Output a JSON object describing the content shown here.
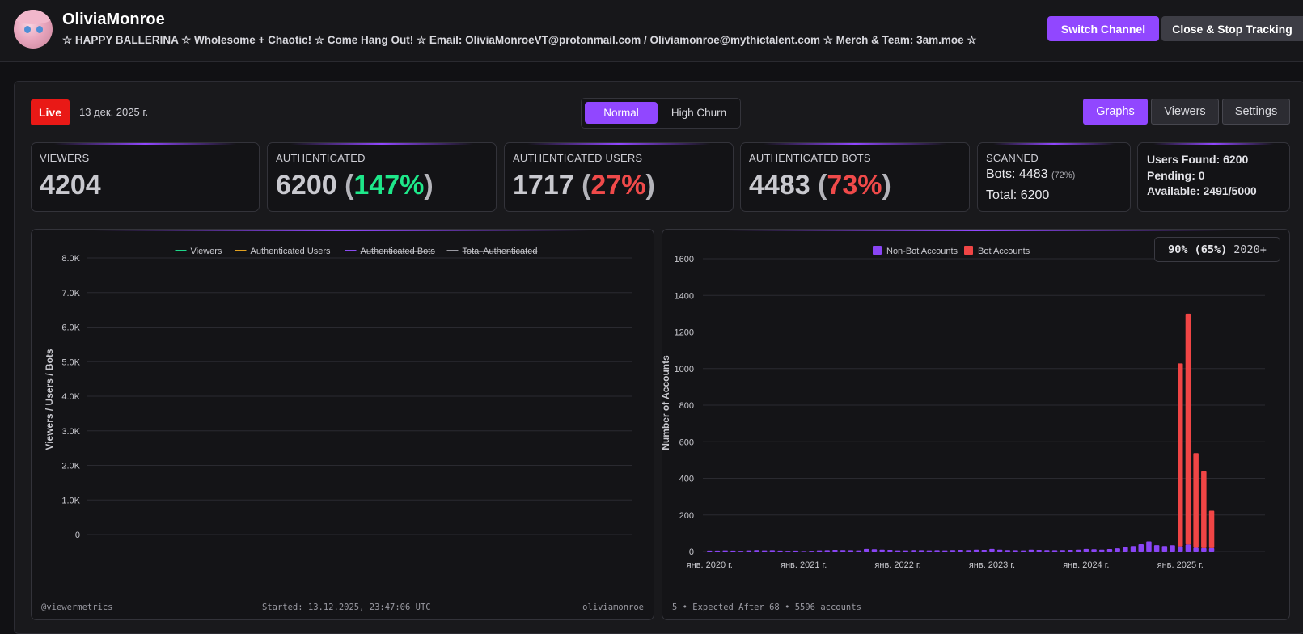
{
  "header": {
    "channel_name": "OliviaMonroe",
    "description": "☆ HAPPY BALLERINA ☆ Wholesome + Chaotic! ☆ Come Hang Out! ☆ Email: OliviaMonroeVT@protonmail.com / Oliviamonroe@mythictalent.com ☆ Merch & Team: 3am.moe ☆",
    "switch_channel_label": "Switch Channel",
    "close_label": "Close & Stop Tracking"
  },
  "status": {
    "live_label": "Live",
    "date": "13 дек. 2025 г."
  },
  "modes": {
    "normal": "Normal",
    "high_churn": "High Churn",
    "selected": "Normal"
  },
  "tabs": {
    "graphs": "Graphs",
    "viewers": "Viewers",
    "settings": "Settings",
    "selected": "Graphs"
  },
  "stats": {
    "viewers": {
      "label": "VIEWERS",
      "value": "4204"
    },
    "authenticated": {
      "label": "AUTHENTICATED",
      "value": "6200",
      "pct": "147%"
    },
    "auth_users": {
      "label": "AUTHENTICATED USERS",
      "value": "1717",
      "pct": "27%"
    },
    "auth_bots": {
      "label": "AUTHENTICATED BOTS",
      "value": "4483",
      "pct": "73%"
    },
    "scanned": {
      "label": "SCANNED",
      "bots_label": "Bots:",
      "bots_value": "4483",
      "bots_pct": "(72%)",
      "total_label": "Total:",
      "total_value": "6200"
    },
    "found": {
      "users_found": "Users Found: 6200",
      "pending": "Pending: 0",
      "available": "Available: 2491/5000"
    }
  },
  "colors": {
    "accent": "#9147ff",
    "live": "#e91916",
    "green": "#1ee88a",
    "red": "#f04a4a",
    "viewers_line": "#1ed68a",
    "users_line": "#e0a020",
    "bots_line": "#8a4cf0",
    "total_line": "#9a9aa2",
    "bot_bar": "#f04545",
    "nonbot_bar": "#8a45f5"
  },
  "chart_data": [
    {
      "type": "line",
      "title": "",
      "ylabel": "Viewers / Users / Bots",
      "ylim": [
        0,
        8000
      ],
      "y_ticks": [
        "0",
        "1.0K",
        "2.0K",
        "3.0K",
        "4.0K",
        "5.0K",
        "6.0K",
        "7.0K",
        "8.0K"
      ],
      "legend_position": "top-center",
      "grid": true,
      "series": [
        {
          "name": "Viewers",
          "values": [],
          "hidden": false
        },
        {
          "name": "Authenticated Users",
          "values": [],
          "hidden": false
        },
        {
          "name": "Authenticated Bots",
          "values": [],
          "hidden": true
        },
        {
          "name": "Total Authenticated",
          "values": [],
          "hidden": true
        }
      ],
      "footer": {
        "left": "@viewermetrics",
        "center": "Started: 13.12.2025, 23:47:06 UTC",
        "right": "oliviamonroe"
      }
    },
    {
      "type": "bar",
      "stacked": true,
      "title": "",
      "ylabel": "Number of Accounts",
      "ylim": [
        0,
        1600
      ],
      "y_ticks": [
        "0",
        "200",
        "400",
        "600",
        "800",
        "1000",
        "1200",
        "1400",
        "1600"
      ],
      "x_ticks": [
        "янв. 2020 г.",
        "янв. 2021 г.",
        "янв. 2022 г.",
        "янв. 2023 г.",
        "янв. 2024 г.",
        "янв. 2025 г."
      ],
      "legend_position": "top-center",
      "grid": true,
      "categories": [
        "2020-01",
        "2020-02",
        "2020-03",
        "2020-04",
        "2020-05",
        "2020-06",
        "2020-07",
        "2020-08",
        "2020-09",
        "2020-10",
        "2020-11",
        "2020-12",
        "2021-01",
        "2021-02",
        "2021-03",
        "2021-04",
        "2021-05",
        "2021-06",
        "2021-07",
        "2021-08",
        "2021-09",
        "2021-10",
        "2021-11",
        "2021-12",
        "2022-01",
        "2022-02",
        "2022-03",
        "2022-04",
        "2022-05",
        "2022-06",
        "2022-07",
        "2022-08",
        "2022-09",
        "2022-10",
        "2022-11",
        "2022-12",
        "2023-01",
        "2023-02",
        "2023-03",
        "2023-04",
        "2023-05",
        "2023-06",
        "2023-07",
        "2023-08",
        "2023-09",
        "2023-10",
        "2023-11",
        "2023-12",
        "2024-01",
        "2024-02",
        "2024-03",
        "2024-04",
        "2024-05",
        "2024-06",
        "2024-07",
        "2024-08",
        "2024-09",
        "2024-10",
        "2024-11",
        "2024-12",
        "2025-01",
        "2025-02",
        "2025-03",
        "2025-04",
        "2025-05"
      ],
      "series": [
        {
          "name": "Non-Bot Accounts",
          "values": [
            5,
            5,
            6,
            5,
            4,
            6,
            8,
            6,
            7,
            5,
            4,
            5,
            3,
            4,
            6,
            7,
            9,
            8,
            7,
            6,
            14,
            12,
            10,
            9,
            6,
            6,
            8,
            7,
            6,
            7,
            6,
            8,
            9,
            8,
            10,
            9,
            14,
            10,
            8,
            7,
            6,
            10,
            9,
            8,
            7,
            8,
            9,
            10,
            14,
            12,
            10,
            13,
            17,
            24,
            30,
            40,
            55,
            35,
            30,
            34,
            28,
            38,
            20,
            18,
            18
          ]
        },
        {
          "name": "Bot Accounts",
          "values": [
            0,
            0,
            0,
            0,
            0,
            0,
            0,
            0,
            0,
            0,
            0,
            0,
            0,
            0,
            0,
            0,
            0,
            0,
            0,
            0,
            0,
            0,
            0,
            0,
            0,
            0,
            0,
            0,
            0,
            0,
            0,
            0,
            0,
            0,
            0,
            0,
            0,
            0,
            0,
            0,
            0,
            0,
            0,
            0,
            0,
            0,
            0,
            0,
            0,
            0,
            0,
            0,
            0,
            0,
            0,
            0,
            0,
            0,
            0,
            0,
            1000,
            1262,
            518,
            420,
            205
          ]
        }
      ],
      "ratio_badge": {
        "bold": "90% (65%)",
        "rest": "2020+"
      },
      "footer": {
        "left": "5 • Expected After 68 • 5596 accounts"
      }
    }
  ]
}
